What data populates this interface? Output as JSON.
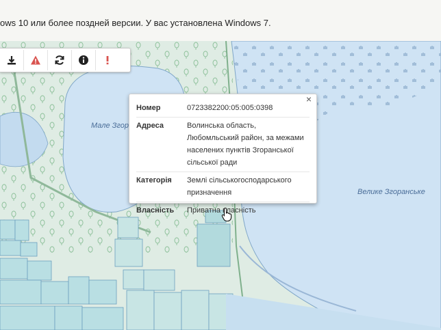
{
  "banner": {
    "text": "ows 10 или более поздней версии. У вас установлена Windows 7."
  },
  "toolbar": {
    "tools": [
      {
        "icon": "download-icon"
      },
      {
        "icon": "warning-icon"
      },
      {
        "icon": "refresh-icon"
      },
      {
        "icon": "info-icon"
      },
      {
        "icon": "exclamation-icon"
      }
    ]
  },
  "map": {
    "labels": {
      "lake_small": "Мале Згоран",
      "lake_large": "Велике Згоранське"
    }
  },
  "popup": {
    "close_label": "×",
    "rows": [
      {
        "key": "Номер",
        "value": "0723382200:05:005:0398"
      },
      {
        "key": "Адреса",
        "value": "Волинська область, Любомльський район, за межами населених пунктів Згоранської сільської ради"
      },
      {
        "key": "Категорія",
        "value": "Землі сільськогосподарського призначення"
      },
      {
        "key": "Власність",
        "value": "Приватна власність"
      }
    ]
  },
  "colors": {
    "water": "#cfe3f4",
    "land": "#dfece4",
    "forest": "#cfe5d3",
    "parcel_fill": "#b9dfe3",
    "parcel_stroke": "#6c9fbf",
    "warning": "#d9534f"
  }
}
